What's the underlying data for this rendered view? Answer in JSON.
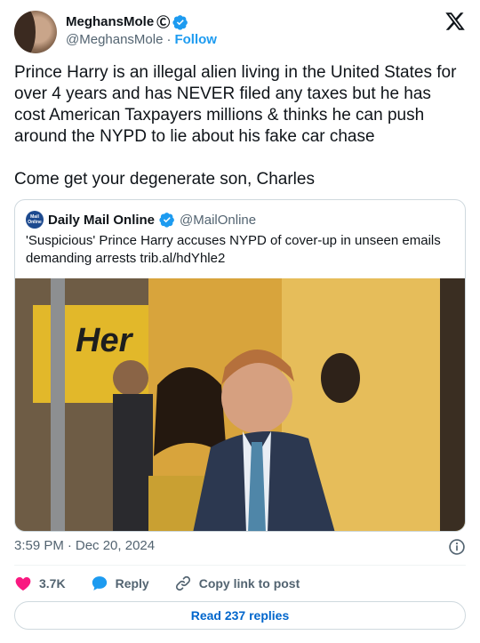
{
  "author": {
    "display_name": "MeghansMole",
    "copyright_mark": "Ⓒ",
    "handle": "@MeghansMole",
    "separator": "·",
    "follow_label": "Follow"
  },
  "tweet": {
    "text": "Prince Harry is an illegal alien living in the United States for over 4 years and has NEVER filed any taxes but he has cost American Taxpayers millions & thinks he can push around the NYPD to lie about his fake car chase\n\nCome get your degenerate son, Charles"
  },
  "quote": {
    "logo_text": "Mail Online",
    "name": "Daily Mail Online",
    "handle": "@MailOnline",
    "text": "'Suspicious' Prince Harry accuses NYPD of cover-up in unseen emails demanding arrests trib.al/hdYhle2",
    "image_sign_text": "Her"
  },
  "meta": {
    "time": "3:59 PM",
    "separator": "·",
    "date": "Dec 20, 2024"
  },
  "actions": {
    "likes": "3.7K",
    "reply_label": "Reply",
    "copy_link_label": "Copy link to post"
  },
  "read_replies_label": "Read 237 replies",
  "colors": {
    "accent": "#1d9bf0",
    "like": "#f91880",
    "text": "#0f1419",
    "muted": "#536471",
    "link": "#0066cc"
  }
}
